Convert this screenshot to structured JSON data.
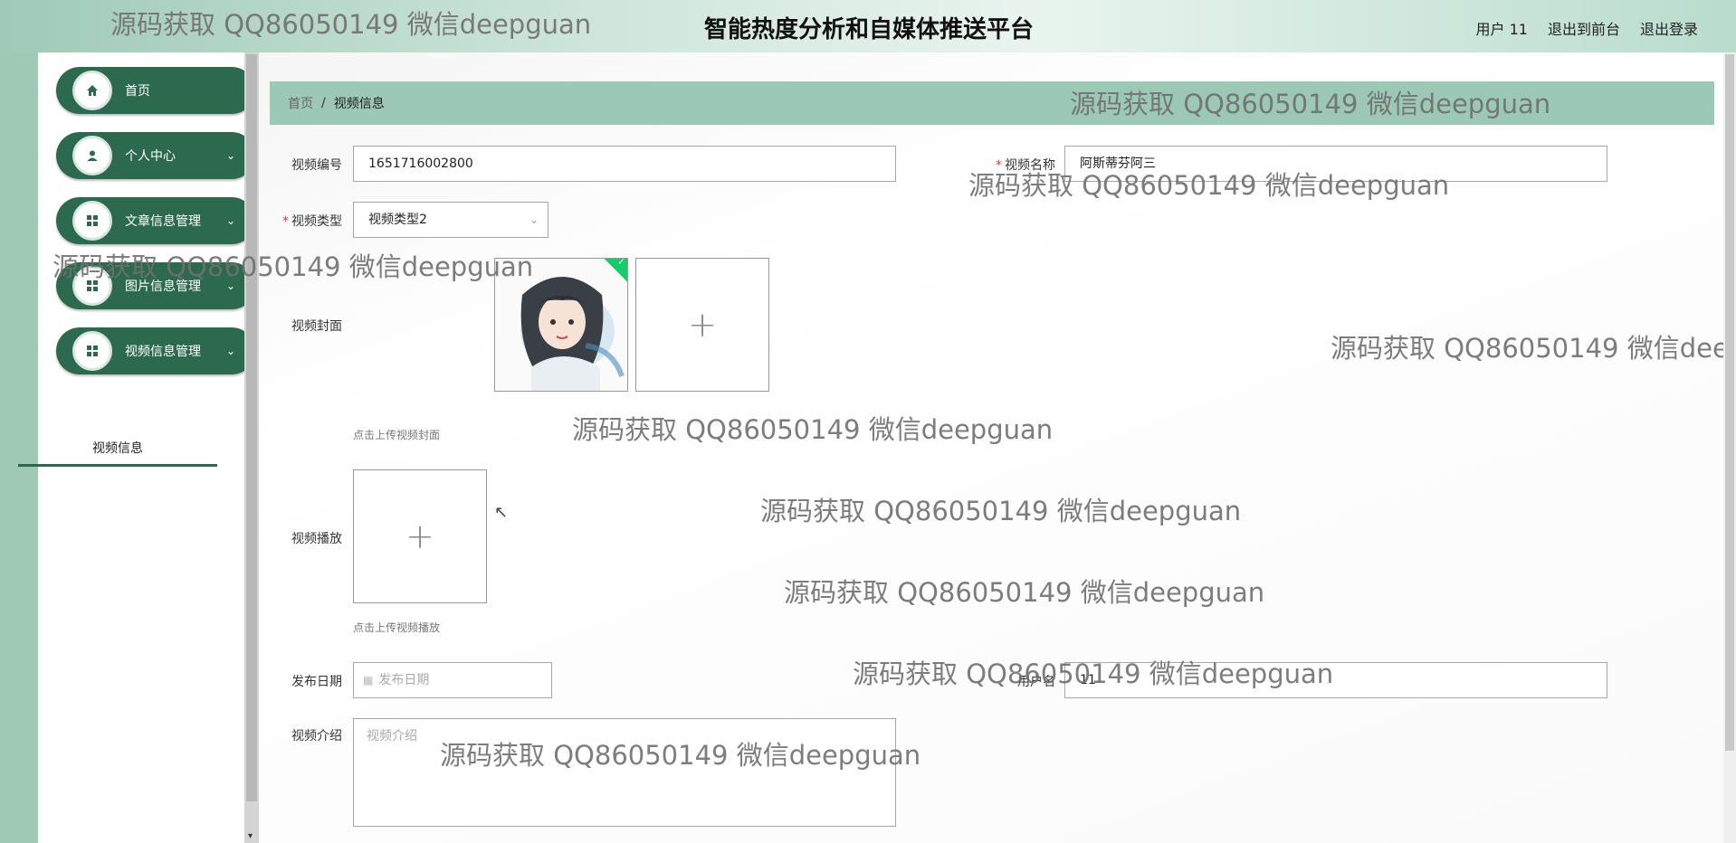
{
  "header": {
    "title": "智能热度分析和自媒体推送平台",
    "user_label": "用户 11",
    "back_to_front": "退出到前台",
    "logout": "退出登录"
  },
  "menu": [
    {
      "label": "首页",
      "icon": "home-icon",
      "expandable": false
    },
    {
      "label": "个人中心",
      "icon": "user-icon",
      "expandable": true
    },
    {
      "label": "文章信息管理",
      "icon": "grid-icon",
      "expandable": true
    },
    {
      "label": "图片信息管理",
      "icon": "grid-icon",
      "expandable": true
    },
    {
      "label": "视频信息管理",
      "icon": "grid-icon",
      "expandable": true
    }
  ],
  "submenu": {
    "label": "视频信息"
  },
  "breadcrumb": {
    "home": "首页",
    "separator": "/",
    "current": "视频信息"
  },
  "form": {
    "video_id": {
      "label": "视频编号",
      "value": "1651716002800"
    },
    "video_name": {
      "label": "视频名称",
      "value": "阿斯蒂芬阿三"
    },
    "video_type": {
      "label": "视频类型",
      "value": "视频类型2"
    },
    "video_cover": {
      "label": "视频封面",
      "hint": "点击上传视频封面"
    },
    "video_play": {
      "label": "视频播放",
      "hint": "点击上传视频播放"
    },
    "publish_date": {
      "label": "发布日期",
      "placeholder": "发布日期"
    },
    "username": {
      "label": "用户名",
      "value": "11"
    },
    "intro": {
      "label": "视频介绍",
      "placeholder": "视频介绍"
    }
  },
  "watermark": "源码获取 QQ86050149 微信deepguan",
  "colors": {
    "accent": "#2c6a4f",
    "breadcrumb_bg": "#9cc9b5",
    "required": "#e53935",
    "upload_success": "#13ce66"
  }
}
